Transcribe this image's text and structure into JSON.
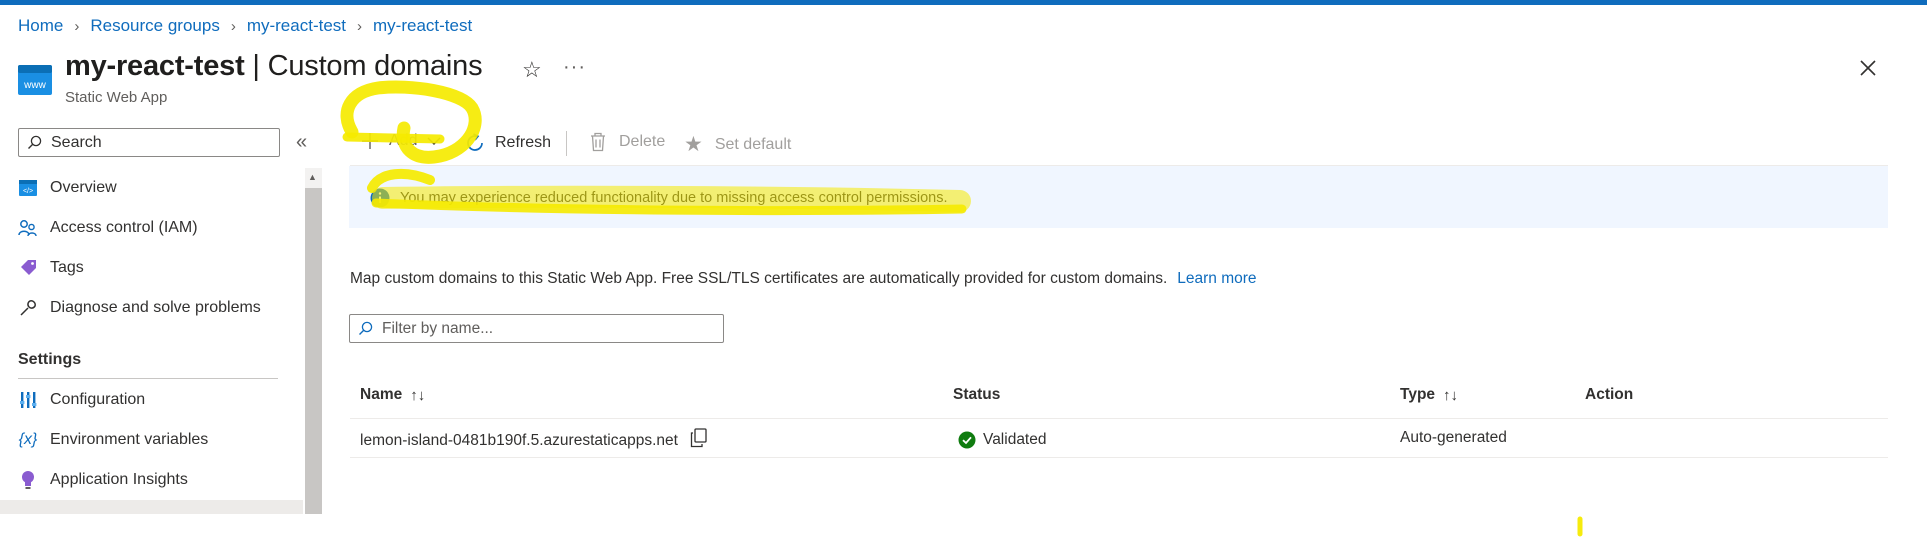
{
  "breadcrumb": [
    "Home",
    "Resource groups",
    "my-react-test",
    "my-react-test"
  ],
  "header": {
    "title_resource": "my-react-test",
    "title_separator": " | ",
    "title_page": "Custom domains",
    "subtitle": "Static Web App"
  },
  "sidebar": {
    "search_placeholder": "Search",
    "items": [
      {
        "label": "Overview",
        "icon": "overview-icon"
      },
      {
        "label": "Access control (IAM)",
        "icon": "people-icon"
      },
      {
        "label": "Tags",
        "icon": "tag-icon"
      },
      {
        "label": "Diagnose and solve problems",
        "icon": "wrench-icon"
      }
    ],
    "settings_header": "Settings",
    "settings_items": [
      {
        "label": "Configuration",
        "icon": "configuration-icon"
      },
      {
        "label": "Environment variables",
        "icon": "variable-icon"
      },
      {
        "label": "Application Insights",
        "icon": "lightbulb-icon"
      }
    ]
  },
  "toolbar": {
    "add": "Add",
    "refresh": "Refresh",
    "delete": "Delete",
    "set_default": "Set default"
  },
  "info_banner": "You may experience reduced functionality due to missing access control permissions.",
  "description": "Map custom domains to this Static Web App. Free SSL/TLS certificates are automatically provided for custom domains.",
  "learn_more": "Learn more",
  "filter_placeholder": "Filter by name...",
  "table": {
    "columns": [
      "Name",
      "Status",
      "Type",
      "Action"
    ],
    "rows": [
      {
        "name": "lemon-island-0481b190f.5.azurestaticapps.net",
        "status": "Validated",
        "type": "Auto-generated",
        "action": ""
      }
    ]
  },
  "colors": {
    "accent": "#0f6cbd",
    "banner_bg": "#f0f6ff",
    "validated": "#107c10",
    "annotation": "#f5ea00"
  }
}
